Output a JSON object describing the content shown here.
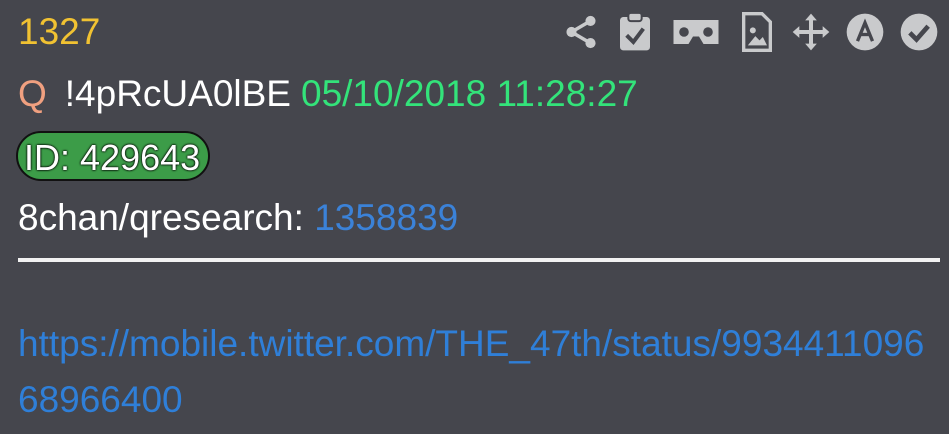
{
  "post": {
    "number": "1327",
    "author": "Q",
    "tripcode": "!4pRcUA0lBE",
    "timestamp": "05/10/2018 11:28:27",
    "id_label": "ID: 429643",
    "board": "8chan/qresearch:",
    "board_ref": "1358839",
    "link": "https://mobile.twitter.com/THE_47th/status/993441109668966400"
  },
  "toolbar": {
    "icons": [
      "share-icon",
      "clipboard-check-icon",
      "vr-goggles-icon",
      "image-file-icon",
      "move-arrows-icon",
      "a-circle-icon",
      "check-circle-icon"
    ]
  },
  "colors": {
    "background": "#45464d",
    "post_number": "#f1c232",
    "author": "#f0a080",
    "timestamp": "#33e37a",
    "id_badge": "#3c9c48",
    "link": "#2f7fd8",
    "icon": "#c9cacc"
  }
}
